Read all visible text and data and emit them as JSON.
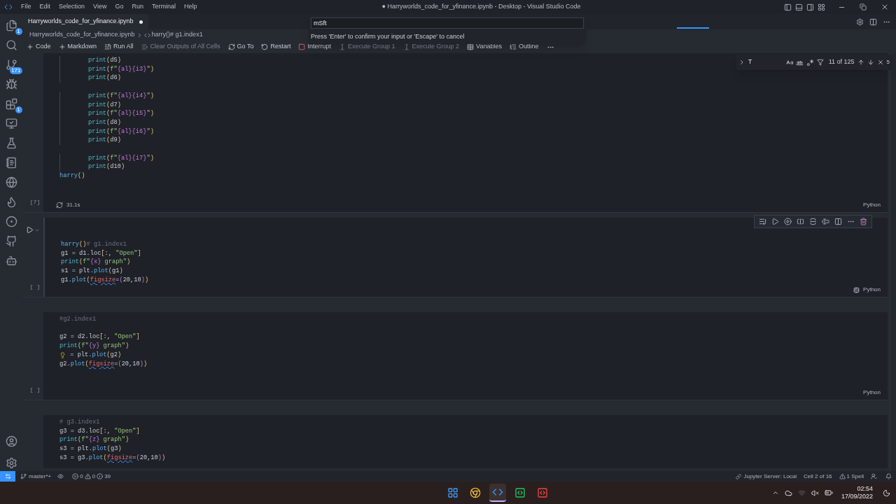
{
  "menu": [
    "File",
    "Edit",
    "Selection",
    "View",
    "Go",
    "Run",
    "Terminal",
    "Help"
  ],
  "title": "● Harryworlds_code_for_yfinance.ipynb - Desktop - Visual Studio Code",
  "tab": {
    "label": "Harryworlds_code_for_yfinance.ipynb",
    "dirty": true
  },
  "command_input": {
    "value": "mSft",
    "hint": "Press 'Enter' to confirm your input or 'Escape' to cancel"
  },
  "breadcrumb": [
    "Harryworlds_code_for_yfinance.ipynb",
    "harry()# g1.index1"
  ],
  "toolbar": [
    {
      "kind": "plus",
      "label": "Code",
      "disabled": false
    },
    {
      "kind": "plus",
      "label": "Markdown",
      "disabled": false
    },
    {
      "kind": "runall",
      "label": "Run All",
      "disabled": false
    },
    {
      "kind": "clear",
      "label": "Clear Outputs of All Cells",
      "disabled": true
    },
    {
      "kind": "goto",
      "label": "Go To",
      "disabled": false
    },
    {
      "kind": "restart",
      "label": "Restart",
      "disabled": false
    },
    {
      "kind": "interrupt",
      "label": "Interrupt",
      "disabled": false
    },
    {
      "kind": "group",
      "label": "Execute Group 1",
      "disabled": true
    },
    {
      "kind": "group",
      "label": "Execute Group 2",
      "disabled": true
    },
    {
      "kind": "variables",
      "label": "Variables",
      "disabled": false
    },
    {
      "kind": "outline",
      "label": "Outline",
      "disabled": false
    }
  ],
  "find": {
    "query": "T",
    "count": "11 of 125",
    "edge": "5"
  },
  "activity": [
    {
      "kind": "files",
      "badge": "1"
    },
    {
      "kind": "search"
    },
    {
      "kind": "git",
      "badge": "171"
    },
    {
      "kind": "debug"
    },
    {
      "kind": "extensions",
      "badge": "1"
    },
    {
      "kind": "remote"
    },
    {
      "kind": "testing"
    },
    {
      "kind": "notebook"
    },
    {
      "kind": "globe"
    },
    {
      "kind": "flame"
    },
    {
      "kind": "circle"
    },
    {
      "kind": "github"
    },
    {
      "kind": "bot"
    }
  ],
  "activity_bottom": [
    {
      "kind": "account"
    },
    {
      "kind": "settings"
    }
  ],
  "cells": [
    {
      "marker": "[7]",
      "time": "31.1s",
      "language": "Python",
      "selected": false,
      "lines": [
        {
          "indented": true,
          "tokens": [
            {
              "text": "print",
              "kind": "fn"
            },
            {
              "text": "(",
              "kind": "br"
            },
            {
              "text": "d5",
              "kind": "tx"
            },
            {
              "text": ")",
              "kind": "br"
            }
          ]
        },
        {
          "indented": true,
          "tokens": [
            {
              "text": "print",
              "kind": "fn"
            },
            {
              "text": "(",
              "kind": "br"
            },
            {
              "text": "f\"",
              "kind": "str"
            },
            {
              "text": "{al}{i3}",
              "kind": "fs"
            },
            {
              "text": "\"",
              "kind": "str"
            },
            {
              "text": ")",
              "kind": "br"
            }
          ]
        },
        {
          "indented": true,
          "tokens": [
            {
              "text": "print",
              "kind": "fn"
            },
            {
              "text": "(",
              "kind": "br"
            },
            {
              "text": "d6",
              "kind": "tx"
            },
            {
              "text": ")",
              "kind": "br"
            }
          ]
        },
        {
          "indented": true,
          "gap_before": true,
          "tokens": [
            {
              "text": "print",
              "kind": "fn"
            },
            {
              "text": "(",
              "kind": "br"
            },
            {
              "text": "f\"",
              "kind": "str"
            },
            {
              "text": "{al}{i4}",
              "kind": "fs"
            },
            {
              "text": "\"",
              "kind": "str"
            },
            {
              "text": ")",
              "kind": "br"
            }
          ]
        },
        {
          "indented": true,
          "tokens": [
            {
              "text": "print",
              "kind": "fn"
            },
            {
              "text": "(",
              "kind": "br"
            },
            {
              "text": "d7",
              "kind": "tx"
            },
            {
              "text": ")",
              "kind": "br"
            }
          ]
        },
        {
          "indented": true,
          "tokens": [
            {
              "text": "print",
              "kind": "fn"
            },
            {
              "text": "(",
              "kind": "br"
            },
            {
              "text": "f\"",
              "kind": "str"
            },
            {
              "text": "{al}{i5}",
              "kind": "fs"
            },
            {
              "text": "\"",
              "kind": "str"
            },
            {
              "text": ")",
              "kind": "br"
            }
          ]
        },
        {
          "indented": true,
          "tokens": [
            {
              "text": "print",
              "kind": "fn"
            },
            {
              "text": "(",
              "kind": "br"
            },
            {
              "text": "d8",
              "kind": "tx"
            },
            {
              "text": ")",
              "kind": "br"
            }
          ]
        },
        {
          "indented": true,
          "tokens": [
            {
              "text": "print",
              "kind": "fn"
            },
            {
              "text": "(",
              "kind": "br"
            },
            {
              "text": "f\"",
              "kind": "str"
            },
            {
              "text": "{al}{i6}",
              "kind": "fs"
            },
            {
              "text": "\"",
              "kind": "str"
            },
            {
              "text": ")",
              "kind": "br"
            }
          ]
        },
        {
          "indented": true,
          "tokens": [
            {
              "text": "print",
              "kind": "fn"
            },
            {
              "text": "(",
              "kind": "br"
            },
            {
              "text": "d9",
              "kind": "tx"
            },
            {
              "text": ")",
              "kind": "br"
            }
          ]
        },
        {
          "indented": true,
          "gap_before": true,
          "tokens": [
            {
              "text": "print",
              "kind": "fn"
            },
            {
              "text": "(",
              "kind": "br"
            },
            {
              "text": "f\"",
              "kind": "str"
            },
            {
              "text": "{al}{i7}",
              "kind": "fs"
            },
            {
              "text": "\"",
              "kind": "str"
            },
            {
              "text": ")",
              "kind": "br"
            }
          ]
        },
        {
          "indented": true,
          "tokens": [
            {
              "text": "print",
              "kind": "fn"
            },
            {
              "text": "(",
              "kind": "br"
            },
            {
              "text": "d10",
              "kind": "tx"
            },
            {
              "text": ")",
              "kind": "br"
            }
          ]
        },
        {
          "indented": false,
          "tokens": [
            {
              "text": "harry",
              "kind": "call"
            },
            {
              "text": "()",
              "kind": "br"
            }
          ]
        }
      ]
    },
    {
      "marker": "[ ]",
      "language": "Python",
      "selected": true,
      "lines": [
        {
          "indented": false,
          "tokens": [
            {
              "text": "harry",
              "kind": "call"
            },
            {
              "text": "()",
              "kind": "br"
            },
            {
              "text": "# g1.index1",
              "kind": "cm"
            }
          ]
        },
        {
          "indented": false,
          "tokens": [
            {
              "text": "g1 = d1.loc",
              "kind": "tx"
            },
            {
              "text": "[",
              "kind": "br"
            },
            {
              "text": ":, ",
              "kind": "tx"
            },
            {
              "text": "\"Open\"",
              "kind": "str"
            },
            {
              "text": "]",
              "kind": "br"
            }
          ]
        },
        {
          "indented": false,
          "tokens": [
            {
              "text": "print",
              "kind": "fn"
            },
            {
              "text": "(",
              "kind": "br"
            },
            {
              "text": "f\"",
              "kind": "str"
            },
            {
              "text": "{x}",
              "kind": "fs"
            },
            {
              "text": " graph\"",
              "kind": "str"
            },
            {
              "text": ")",
              "kind": "br"
            }
          ]
        },
        {
          "indented": false,
          "tokens": [
            {
              "text": "s1 = plt.",
              "kind": "tx"
            },
            {
              "text": "plot",
              "kind": "call"
            },
            {
              "text": "(",
              "kind": "br"
            },
            {
              "text": "g1",
              "kind": "tx"
            },
            {
              "text": ")",
              "kind": "br"
            }
          ]
        },
        {
          "indented": false,
          "tokens": [
            {
              "text": "g1.",
              "kind": "tx"
            },
            {
              "text": "plot",
              "kind": "call"
            },
            {
              "text": "(",
              "kind": "br"
            },
            {
              "text": "figsize",
              "kind": "err"
            },
            {
              "text": "=",
              "kind": "tx"
            },
            {
              "text": "(",
              "kind": "pp"
            },
            {
              "text": "20,10",
              "kind": "tx"
            },
            {
              "text": ")",
              "kind": "pp"
            },
            {
              "text": ")",
              "kind": "br"
            }
          ]
        }
      ]
    },
    {
      "marker": "[ ]",
      "language": "Python",
      "selected": false,
      "lines": [
        {
          "indented": false,
          "tokens": [
            {
              "text": "#g2.index1",
              "kind": "cm"
            }
          ]
        },
        {
          "indented": false,
          "gap_before": true,
          "tokens": [
            {
              "text": "g2 = d2.loc",
              "kind": "tx"
            },
            {
              "text": "[",
              "kind": "br"
            },
            {
              "text": ":, ",
              "kind": "tx"
            },
            {
              "text": "\"Open\"",
              "kind": "str"
            },
            {
              "text": "]",
              "kind": "br"
            }
          ]
        },
        {
          "indented": false,
          "tokens": [
            {
              "text": "print",
              "kind": "fn"
            },
            {
              "text": "(",
              "kind": "br"
            },
            {
              "text": "f\"",
              "kind": "str"
            },
            {
              "text": "{y}",
              "kind": "fs"
            },
            {
              "text": " graph\"",
              "kind": "str"
            },
            {
              "text": ")",
              "kind": "br"
            }
          ]
        },
        {
          "indented": false,
          "lightbulb": true,
          "tokens": [
            {
              "text": " = plt.",
              "kind": "tx"
            },
            {
              "text": "plot",
              "kind": "call"
            },
            {
              "text": "(",
              "kind": "br"
            },
            {
              "text": "g2",
              "kind": "tx"
            },
            {
              "text": ")",
              "kind": "br"
            }
          ]
        },
        {
          "indented": false,
          "tokens": [
            {
              "text": "g2.",
              "kind": "tx"
            },
            {
              "text": "plot",
              "kind": "call"
            },
            {
              "text": "(",
              "kind": "br"
            },
            {
              "text": "figsize",
              "kind": "err"
            },
            {
              "text": "=",
              "kind": "tx"
            },
            {
              "text": "(",
              "kind": "pp"
            },
            {
              "text": "20,10",
              "kind": "tx"
            },
            {
              "text": ")",
              "kind": "pp"
            },
            {
              "text": ")",
              "kind": "br"
            }
          ]
        }
      ]
    },
    {
      "selected": false,
      "lines": [
        {
          "indented": false,
          "tokens": [
            {
              "text": "# g3.index1",
              "kind": "cm"
            }
          ]
        },
        {
          "indented": false,
          "tokens": [
            {
              "text": "g3 = d3.loc",
              "kind": "tx"
            },
            {
              "text": "[",
              "kind": "br"
            },
            {
              "text": ":, ",
              "kind": "tx"
            },
            {
              "text": "\"Open\"",
              "kind": "str"
            },
            {
              "text": "]",
              "kind": "br"
            }
          ]
        },
        {
          "indented": false,
          "tokens": [
            {
              "text": "print",
              "kind": "fn"
            },
            {
              "text": "(",
              "kind": "br"
            },
            {
              "text": "f\"",
              "kind": "str"
            },
            {
              "text": "{z}",
              "kind": "fs"
            },
            {
              "text": " graph\"",
              "kind": "str"
            },
            {
              "text": ")",
              "kind": "br"
            }
          ]
        },
        {
          "indented": false,
          "tokens": [
            {
              "text": "s3 = plt.",
              "kind": "tx"
            },
            {
              "text": "plot",
              "kind": "call"
            },
            {
              "text": "(",
              "kind": "br"
            },
            {
              "text": "g3",
              "kind": "tx"
            },
            {
              "text": ")",
              "kind": "br"
            }
          ]
        },
        {
          "indented": false,
          "tokens": [
            {
              "text": "s3 = g3.",
              "kind": "tx"
            },
            {
              "text": "plot",
              "kind": "call"
            },
            {
              "text": "(",
              "kind": "br"
            },
            {
              "text": "figsize",
              "kind": "err"
            },
            {
              "text": "=",
              "kind": "tx"
            },
            {
              "text": "(",
              "kind": "pp"
            },
            {
              "text": "20,10",
              "kind": "tx"
            },
            {
              "text": ")",
              "kind": "pp"
            },
            {
              "text": ")",
              "kind": "br"
            }
          ]
        }
      ]
    }
  ],
  "status": {
    "branch": "master*+",
    "errors": "0",
    "warnings": "0",
    "info": "39",
    "server": "Jupyter Server: Local",
    "cell": "Cell 2 of 16",
    "spell": "1 Spell"
  },
  "taskbar": {
    "apps": [
      {
        "kind": "start",
        "active": false
      },
      {
        "kind": "chrome",
        "active": false
      },
      {
        "kind": "vscode",
        "active": true
      },
      {
        "kind": "green",
        "active": false
      },
      {
        "kind": "red",
        "active": false
      }
    ],
    "time": "02:54",
    "date": "17/09/2022"
  }
}
